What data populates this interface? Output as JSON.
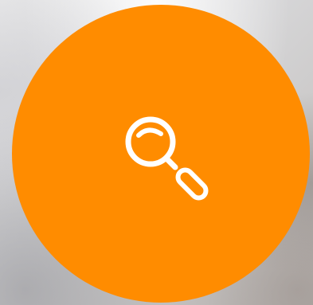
{
  "background": {
    "style": "blurred-photo"
  },
  "search_button": {
    "color": "#ff8c00",
    "icon": "magnifying-glass-icon",
    "icon_color": "#ffffff"
  }
}
